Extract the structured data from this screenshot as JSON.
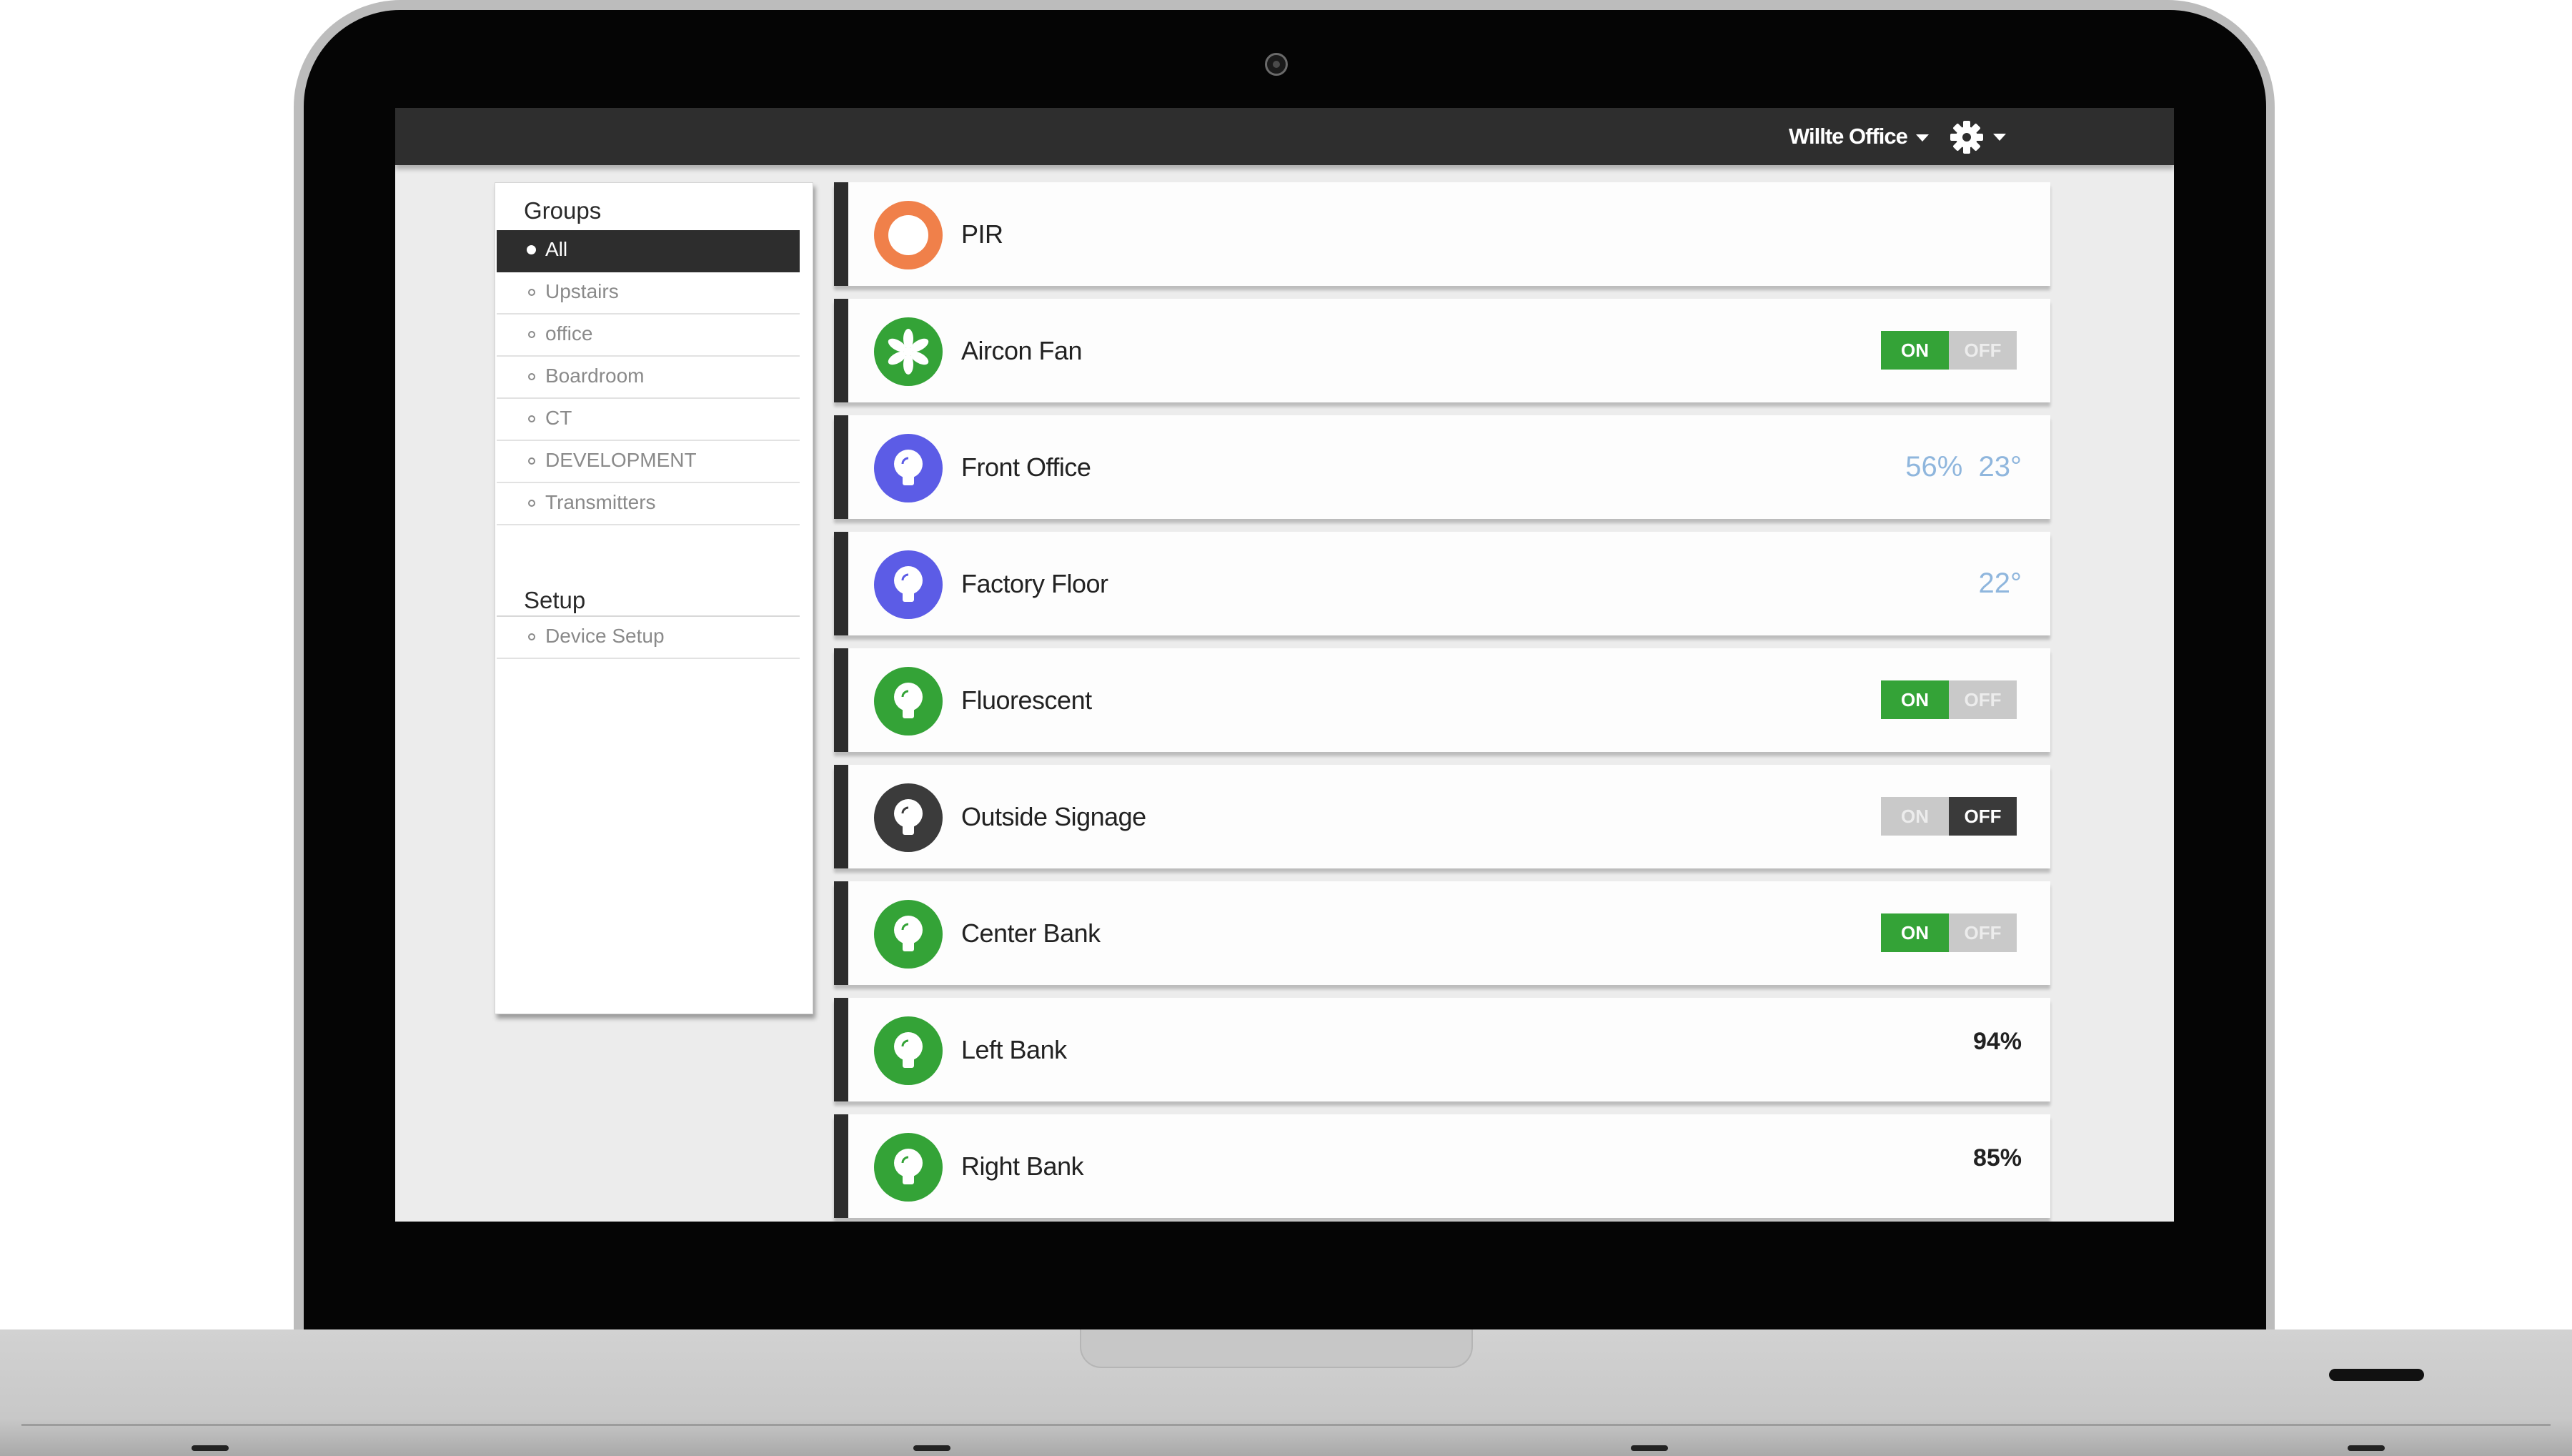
{
  "header": {
    "location_label": "Willte Office",
    "settings_icon": "gear-icon"
  },
  "sidebar": {
    "groups_title": "Groups",
    "groups": [
      {
        "label": "All",
        "active": true
      },
      {
        "label": "Upstairs",
        "active": false
      },
      {
        "label": "office",
        "active": false
      },
      {
        "label": "Boardroom",
        "active": false
      },
      {
        "label": "CT",
        "active": false
      },
      {
        "label": "DEVELOPMENT",
        "active": false
      },
      {
        "label": "Transmitters",
        "active": false
      }
    ],
    "setup_title": "Setup",
    "setup_items": [
      {
        "label": "Device Setup"
      }
    ]
  },
  "colors": {
    "orange": "#f0804a",
    "green": "#34a337",
    "purple": "#5c5ce6",
    "dark": "#3b3b3b",
    "readout_blue": "#8fb6dd"
  },
  "devices": [
    {
      "name": "PIR",
      "icon": "ring-icon",
      "color": "#f0804a"
    },
    {
      "name": "Aircon Fan",
      "icon": "fan-icon",
      "color": "#34a337",
      "toggle": {
        "on_label": "ON",
        "off_label": "OFF",
        "state": "on"
      }
    },
    {
      "name": "Front Office",
      "icon": "bulb-icon",
      "color": "#5c5ce6",
      "readout": {
        "humidity": "56%",
        "temperature": "23°"
      }
    },
    {
      "name": "Factory Floor",
      "icon": "bulb-icon",
      "color": "#5c5ce6",
      "readout": {
        "temperature": "22°"
      }
    },
    {
      "name": "Fluorescent",
      "icon": "bulb-icon",
      "color": "#34a337",
      "toggle": {
        "on_label": "ON",
        "off_label": "OFF",
        "state": "on"
      }
    },
    {
      "name": "Outside Signage",
      "icon": "bulb-icon",
      "color": "#3b3b3b",
      "toggle": {
        "on_label": "ON",
        "off_label": "OFF",
        "state": "off"
      }
    },
    {
      "name": "Center Bank",
      "icon": "bulb-icon",
      "color": "#34a337",
      "toggle": {
        "on_label": "ON",
        "off_label": "OFF",
        "state": "on"
      }
    },
    {
      "name": "Left Bank",
      "icon": "bulb-icon",
      "color": "#34a337",
      "level": "94%"
    },
    {
      "name": "Right Bank",
      "icon": "bulb-icon",
      "color": "#34a337",
      "level": "85%"
    }
  ]
}
